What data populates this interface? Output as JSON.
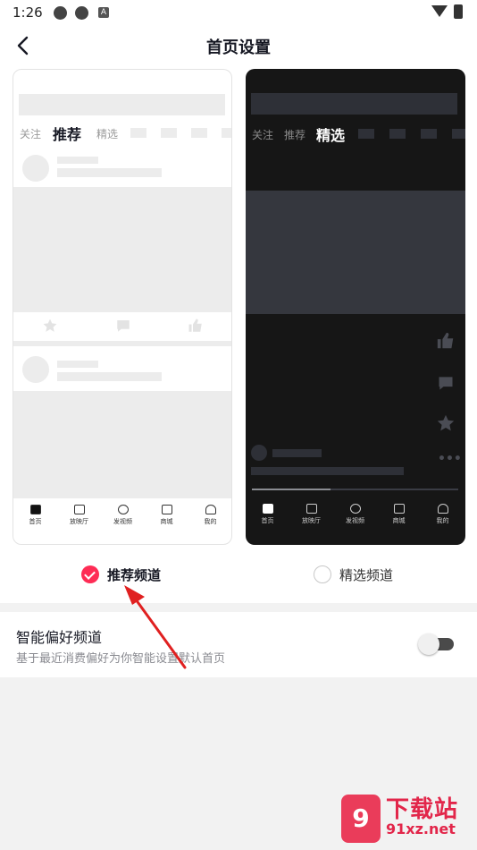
{
  "status_bar": {
    "time": "1:26",
    "badge": "A"
  },
  "header": {
    "title": "首页设置",
    "back_icon": "chevron-left-icon"
  },
  "preview_light": {
    "tabs": [
      "关注",
      "推荐",
      "精选"
    ],
    "active_tab": "推荐",
    "bottom_nav": [
      "首页",
      "放映厅",
      "发视频",
      "商城",
      "我的"
    ]
  },
  "preview_dark": {
    "tabs": [
      "关注",
      "推荐",
      "精选"
    ],
    "active_tab": "精选",
    "bottom_nav": [
      "首页",
      "放映厅",
      "发视频",
      "商城",
      "我的"
    ]
  },
  "options": [
    {
      "label": "推荐频道",
      "selected": true
    },
    {
      "label": "精选频道",
      "selected": false
    }
  ],
  "smart_setting": {
    "title": "智能偏好频道",
    "subtitle": "基于最近消费偏好为你智能设置默认首页",
    "enabled": false
  },
  "colors": {
    "accent": "#fe2c55",
    "arrow": "#e02020",
    "watermark": "#e2264a"
  },
  "watermark": {
    "logo": "9",
    "text": "下载站",
    "url": "91xz.net"
  }
}
